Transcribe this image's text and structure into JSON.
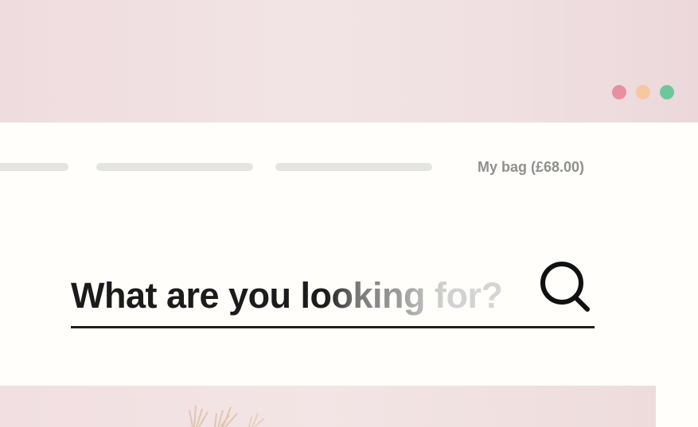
{
  "window": {
    "dots": [
      "#e8909f",
      "#f5c8a0",
      "#6ec69a"
    ]
  },
  "nav": {
    "links": [
      "",
      "",
      ""
    ],
    "bag_label": "My bag (£68.00)"
  },
  "search": {
    "placeholder": "What are you looking for?",
    "icon": "search-icon"
  },
  "colors": {
    "background": "#f0dfe1",
    "panel": "#fffefb",
    "text": "#1b1b1b",
    "muted": "#8f8f8f"
  }
}
